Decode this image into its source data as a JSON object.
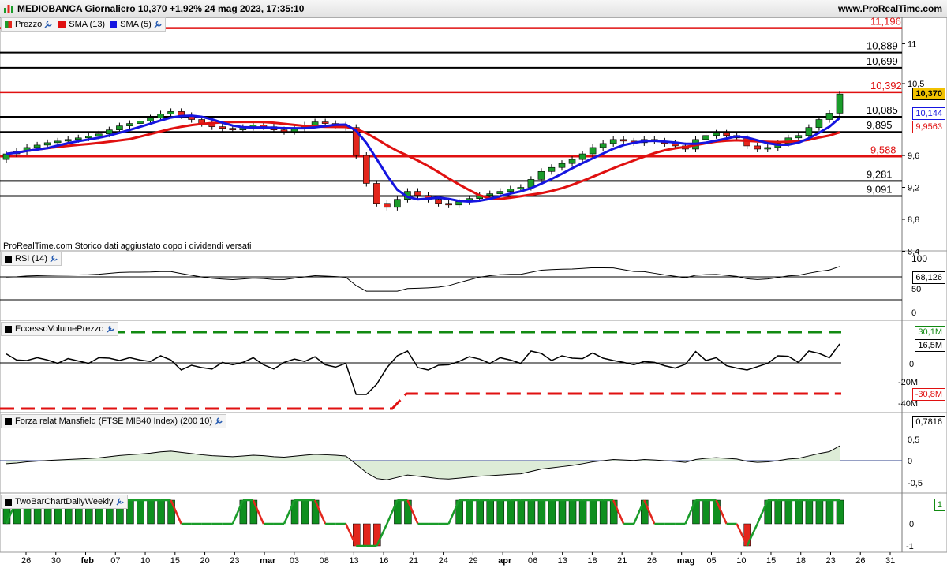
{
  "header": {
    "title": "MEDIOBANCA Giornaliero 10,370 +1,92% 24 mag 2023, 17:35:10",
    "site": "www.ProRealTime.com"
  },
  "price_panel": {
    "legend": {
      "price": "Prezzo",
      "sma13": "SMA (13)",
      "sma5": "SMA (5)"
    },
    "note": "ProRealTime.com Storico dati aggiustato dopo i dividendi versati",
    "axis_ticks": [
      "11",
      "10,5",
      "9,6",
      "9,2",
      "8,8",
      "8,4"
    ],
    "levels_black": [
      "10,889",
      "10,699",
      "10,085",
      "9,895",
      "9,281",
      "9,091"
    ],
    "levels_red": [
      "11,196",
      "10,392",
      "9,588"
    ],
    "last_price": "10,370",
    "sma5_value": "10,144",
    "sma13_value": "9,9563"
  },
  "rsi_panel": {
    "legend": "RSI (14)",
    "ticks": [
      "100",
      "50",
      "0"
    ],
    "value": "68,126"
  },
  "volume_panel": {
    "legend": "EccessoVolumePrezzo",
    "ticks": [
      "-20M",
      "-40M",
      "0"
    ],
    "upper": "30,1M",
    "value": "16,5M",
    "zero": "0",
    "lower": "-30,8M"
  },
  "mansfield_panel": {
    "legend": "Forza relat Mansfield (FTSE MIB40 Index) (200 10)",
    "ticks": [
      "0,5",
      "0",
      "-0,5"
    ],
    "value": "0,7816"
  },
  "twobar_panel": {
    "legend": "TwoBarChartDailyWeekly",
    "ticks": [
      "0",
      "-1"
    ],
    "value": "1"
  },
  "x_axis": {
    "labels": [
      "26",
      "30",
      "feb",
      "07",
      "10",
      "15",
      "20",
      "23",
      "mar",
      "03",
      "08",
      "13",
      "16",
      "21",
      "24",
      "29",
      "apr",
      "06",
      "13",
      "18",
      "21",
      "26",
      "mag",
      "05",
      "10",
      "15",
      "18",
      "23",
      "26",
      "31"
    ]
  },
  "colors": {
    "up": "#1a9c2a",
    "down": "#e3261c",
    "sma5": "#1515e0",
    "sma13": "#e01010",
    "volume_band": "#118a11",
    "area_up": "#d9ead3",
    "area_down": "#e8cfcf"
  },
  "icons": [
    "app-icon",
    "wrench-icon"
  ],
  "chart_data": {
    "type": "candlestick",
    "closes": [
      9.62,
      9.65,
      9.7,
      9.73,
      9.76,
      9.78,
      9.8,
      9.82,
      9.84,
      9.87,
      9.92,
      9.97,
      10.0,
      10.03,
      10.07,
      10.12,
      10.15,
      10.1,
      10.05,
      10.0,
      9.96,
      9.94,
      9.92,
      9.95,
      9.98,
      9.96,
      9.92,
      9.9,
      9.94,
      9.98,
      10.02,
      10.0,
      9.98,
      9.95,
      9.6,
      9.25,
      9.0,
      8.95,
      9.05,
      9.15,
      9.1,
      9.05,
      9.0,
      8.98,
      9.02,
      9.06,
      9.1,
      9.12,
      9.15,
      9.18,
      9.2,
      9.3,
      9.4,
      9.45,
      9.5,
      9.55,
      9.62,
      9.7,
      9.75,
      9.8,
      9.78,
      9.76,
      9.8,
      9.78,
      9.75,
      9.72,
      9.68,
      9.8,
      9.85,
      9.88,
      9.85,
      9.82,
      9.72,
      9.68,
      9.7,
      9.75,
      9.82,
      9.85,
      9.95,
      10.05,
      10.13,
      10.37
    ],
    "sma5_last": 10.144,
    "sma13_last": 9.9563
  }
}
